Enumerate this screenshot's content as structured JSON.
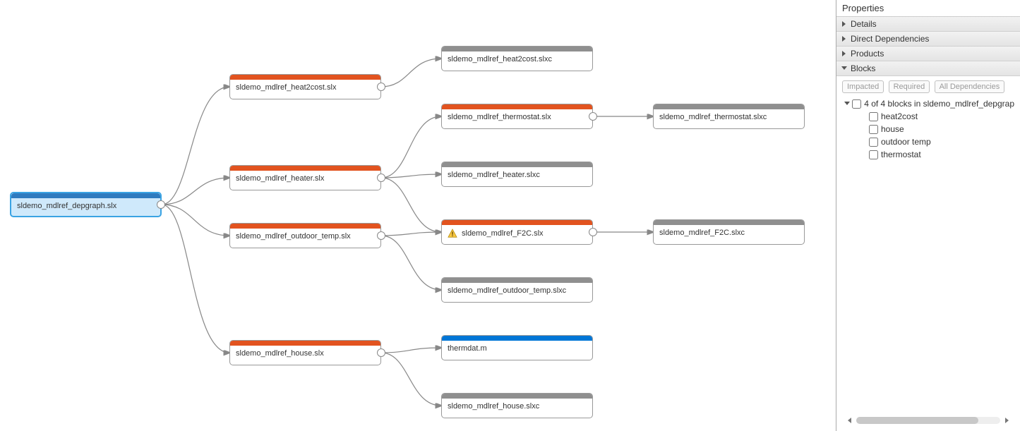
{
  "panel": {
    "title": "Properties",
    "sections": {
      "details": "Details",
      "directDependencies": "Direct Dependencies",
      "products": "Products",
      "blocks": "Blocks"
    },
    "blocks": {
      "pills": {
        "impacted": "Impacted",
        "required": "Required",
        "allDeps": "All Dependencies"
      },
      "root": "4 of 4 blocks in sldemo_mdlref_depgrap",
      "items": [
        "heat2cost",
        "house",
        "outdoor temp",
        "thermostat"
      ]
    }
  },
  "nodes": {
    "root": {
      "label": "sldemo_mdlref_depgraph.slx"
    },
    "heat2cost": {
      "label": "sldemo_mdlref_heat2cost.slx"
    },
    "heater": {
      "label": "sldemo_mdlref_heater.slx"
    },
    "outdoor": {
      "label": "sldemo_mdlref_outdoor_temp.slx"
    },
    "house": {
      "label": "sldemo_mdlref_house.slx"
    },
    "heat2cost_c": {
      "label": "sldemo_mdlref_heat2cost.slxc"
    },
    "thermostat": {
      "label": "sldemo_mdlref_thermostat.slx"
    },
    "heater_c": {
      "label": "sldemo_mdlref_heater.slxc"
    },
    "f2c": {
      "label": "sldemo_mdlref_F2C.slx"
    },
    "outdoor_c": {
      "label": "sldemo_mdlref_outdoor_temp.slxc"
    },
    "thermdat": {
      "label": "thermdat.m"
    },
    "house_c": {
      "label": "sldemo_mdlref_house.slxc"
    },
    "thermostat_c": {
      "label": "sldemo_mdlref_thermostat.slxc"
    },
    "f2c_c": {
      "label": "sldemo_mdlref_F2C.slxc"
    }
  }
}
